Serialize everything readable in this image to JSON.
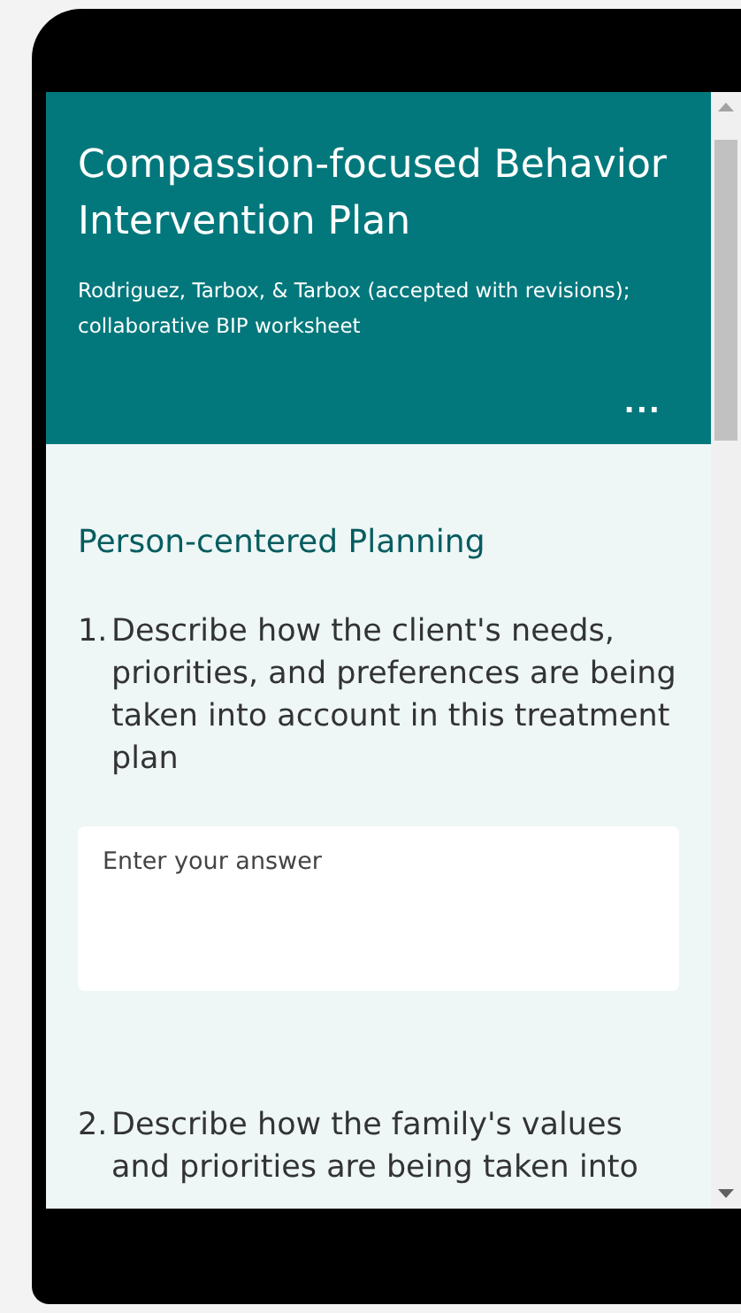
{
  "form": {
    "title": "Compassion-focused Behavior Intervention Plan",
    "subtitle": "Rodriguez, Tarbox, & Tarbox (accepted with revisions); collaborative BIP worksheet",
    "more_button": "...",
    "section_title": "Person-centered Planning",
    "questions": [
      {
        "number": "1.",
        "text": "Describe how the client's needs, priorities, and preferences are being taken into account in this treatment plan",
        "answer": {
          "placeholder": "Enter your answer"
        }
      },
      {
        "number": "2.",
        "text": "Describe how the family's values and priorities are being taken into"
      }
    ]
  }
}
